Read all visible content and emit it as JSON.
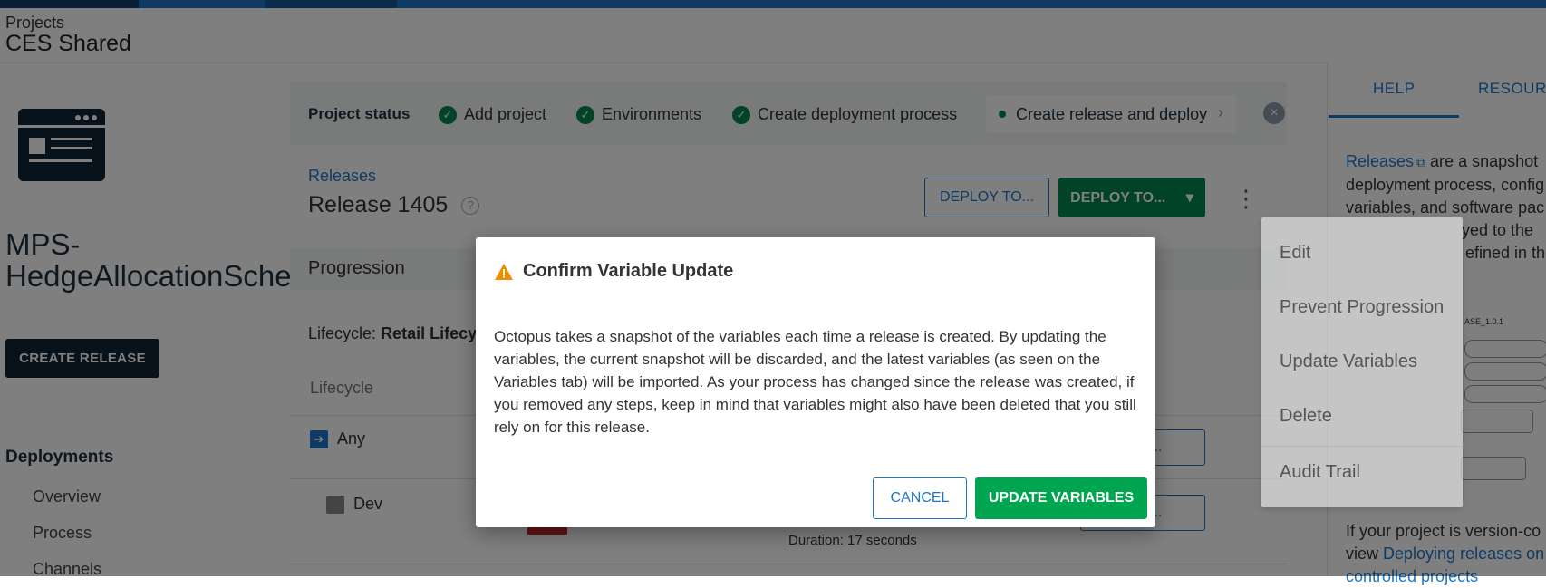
{
  "header": {
    "breadcrumb": "Projects",
    "project_group": "CES Shared"
  },
  "sidebar": {
    "project_name": "MPS-HedgeAllocationScheduleProcessor",
    "create_release": "CREATE RELEASE",
    "section_title": "Deployments",
    "links": [
      "Overview",
      "Process",
      "Channels"
    ]
  },
  "status": {
    "label": "Project status",
    "steps": [
      "Add project",
      "Environments",
      "Create deployment process"
    ],
    "current": "Create release and deploy"
  },
  "release": {
    "link": "Releases",
    "title": "Release 1405",
    "deploy_outline": "DEPLOY TO...",
    "deploy_primary": "DEPLOY TO..."
  },
  "progression": {
    "title": "Progression",
    "lifecycle_prefix": "Lifecycle:",
    "lifecycle_name": "Retail Lifecy",
    "column": "Lifecycle",
    "envs": [
      "Any",
      "Dev"
    ],
    "duration": "Duration: 17 seconds",
    "env_button": "...IN..."
  },
  "help": {
    "tabs": [
      "HELP",
      "RESOUR"
    ],
    "para_lines": [
      "Releases",
      " are a snapshot",
      "deployment process, config",
      "variables, and software pac",
      "yed to the",
      "efined in the"
    ],
    "para2_lines": [
      "If your project is version-co",
      "view ",
      "Deploying releases on",
      "controlled projects"
    ]
  },
  "menu": {
    "items": [
      "Edit",
      "Prevent Progression",
      "Update Variables",
      "Delete",
      "Audit Trail"
    ]
  },
  "dialog": {
    "title": "Confirm Variable Update",
    "body": "Octopus takes a snapshot of the variables each time a release is created. By updating the variables, the current snapshot will be discarded, and the latest variables (as seen on the Variables tab) will be imported. As your process has changed since the release was created, if you removed any steps, keep in mind that variables might also have been deleted that you still rely on for this release.",
    "cancel": "CANCEL",
    "confirm": "UPDATE VARIABLES"
  },
  "colors": {
    "accent": "#1a77ca",
    "success": "#00a551",
    "warning": "#f08c00",
    "dark": "#0f2535"
  }
}
